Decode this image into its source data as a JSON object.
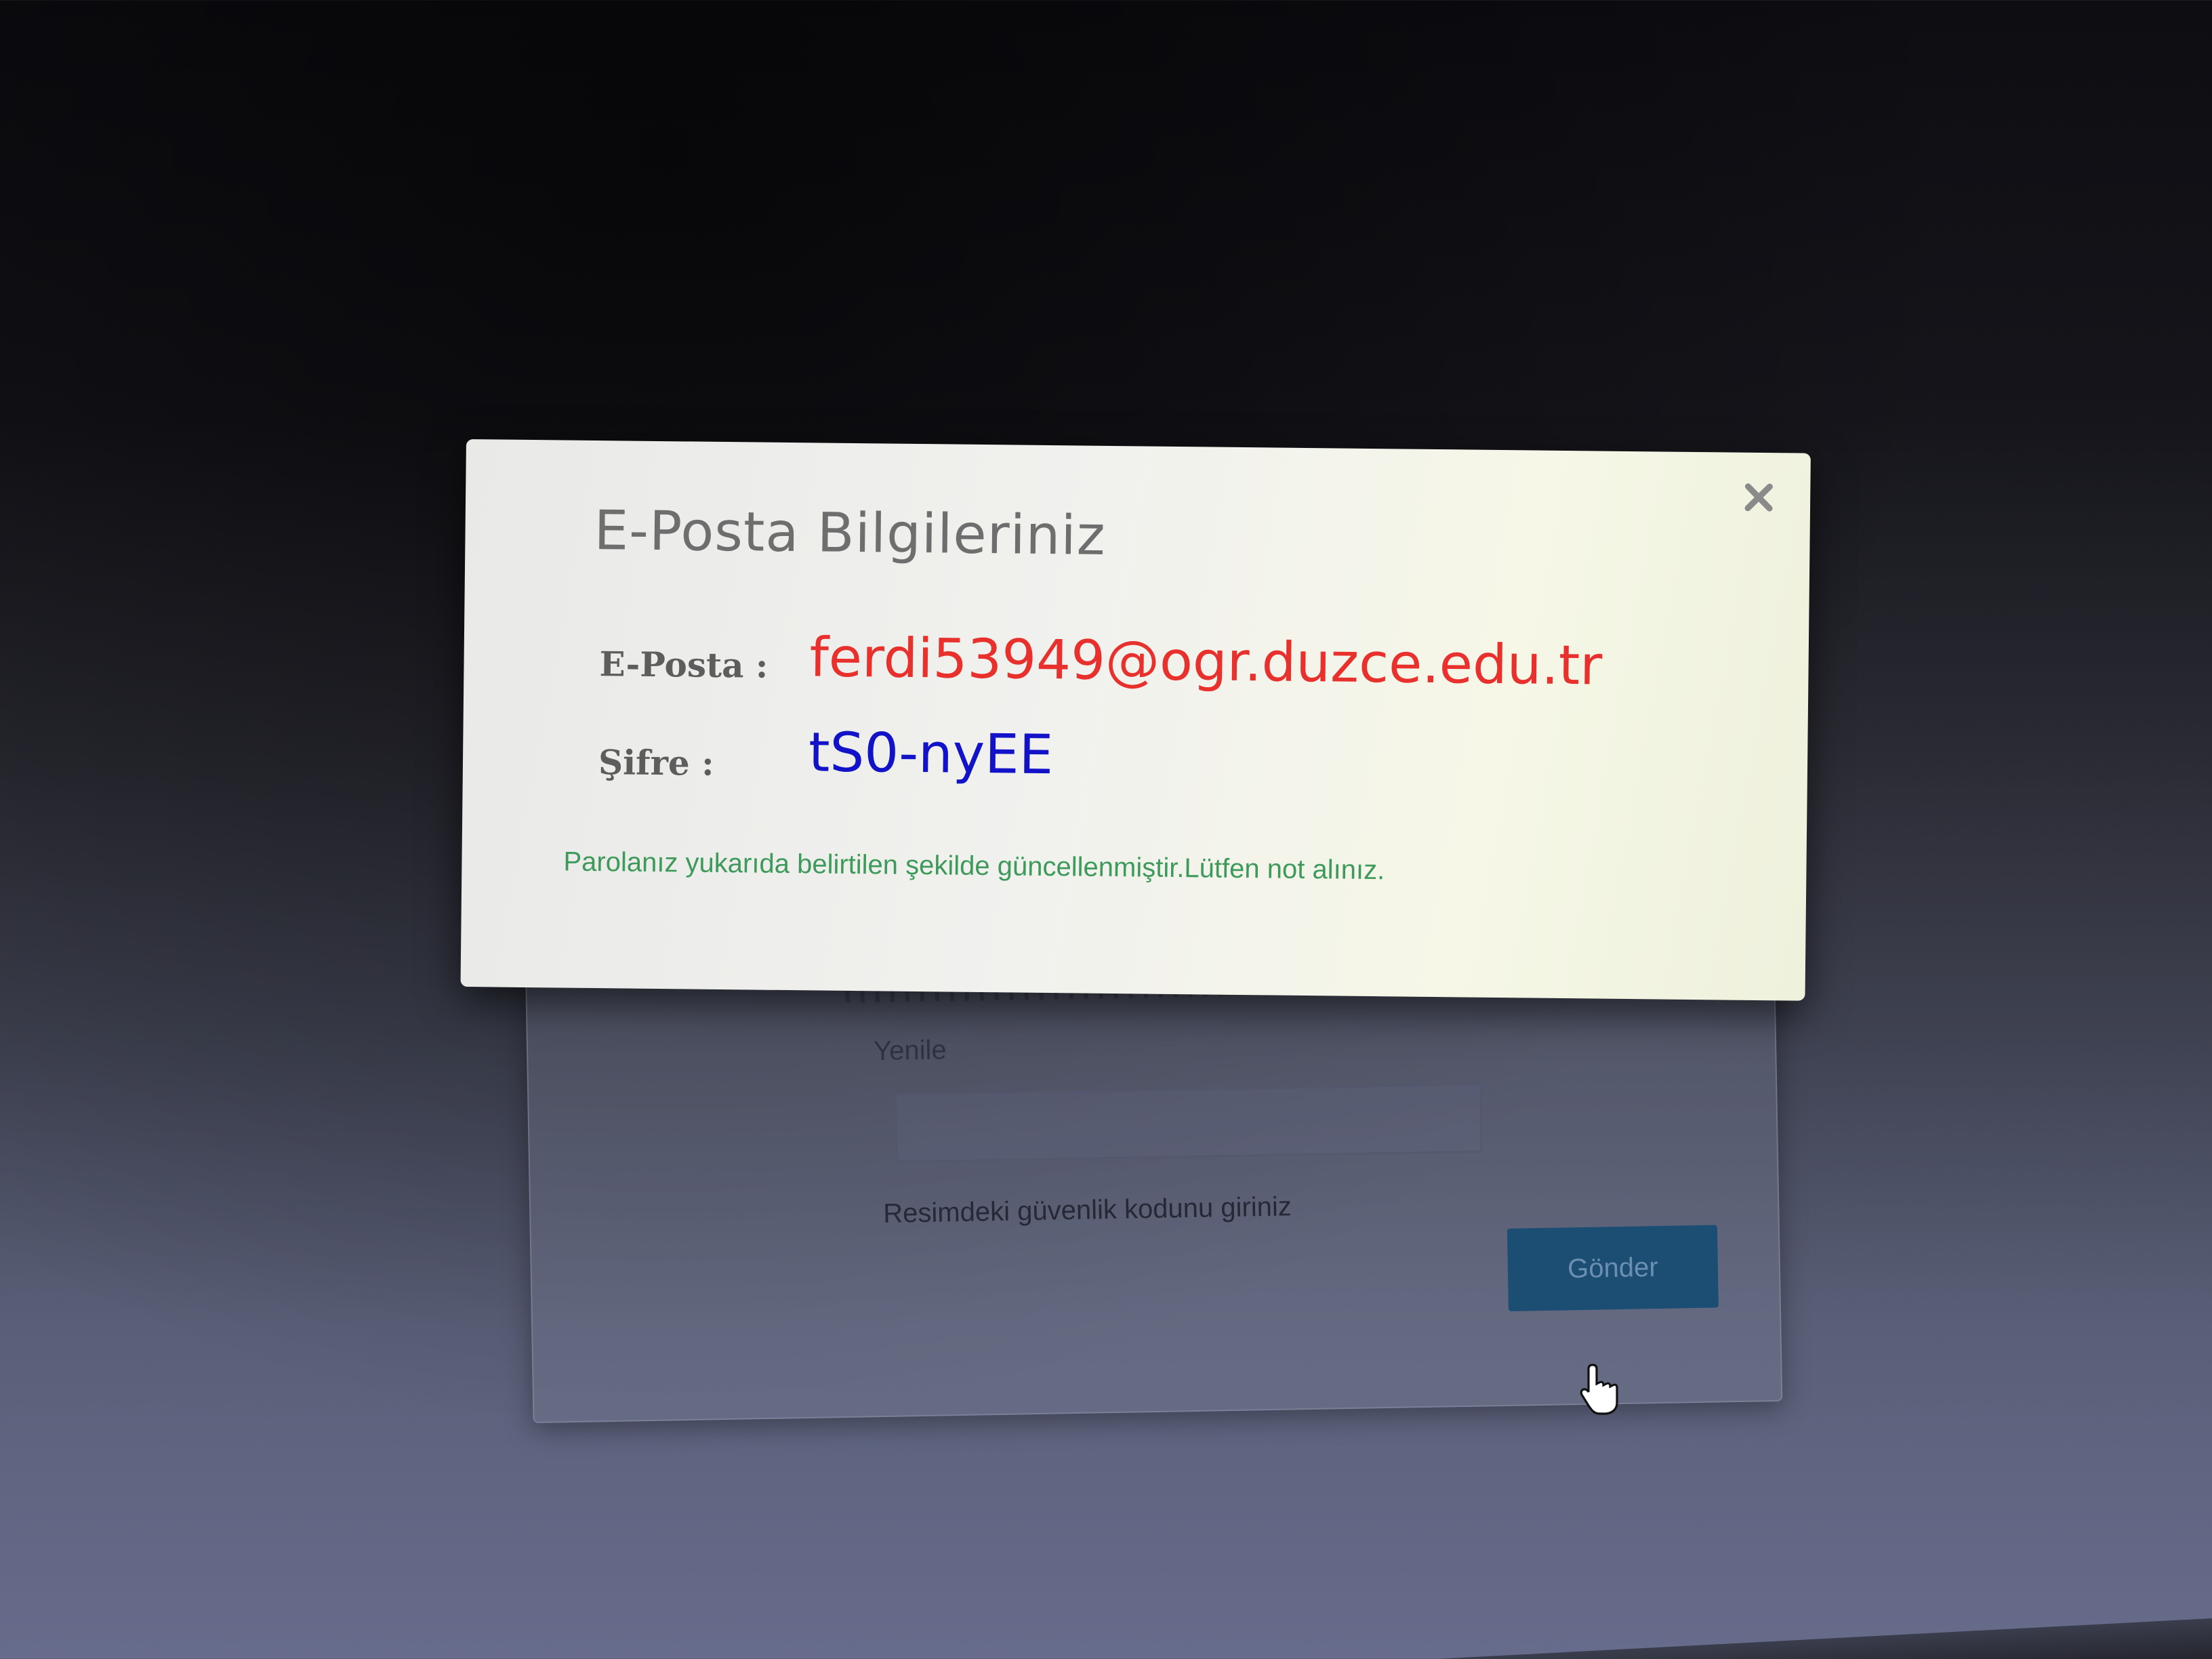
{
  "modal": {
    "title": "E-Posta Bilgileriniz",
    "close_glyph": "×",
    "email_label": "E-Posta :",
    "email_value": "ferdi53949@ogr.duzce.edu.tr",
    "password_label": "Şifre :",
    "password_value": "tS0-nyEE",
    "notice": "Parolanız yukarıda belirtilen şekilde güncellenmiştir.Lütfen not alınız."
  },
  "background_form": {
    "refresh_label": "Yenile",
    "code_hint": "Resimdeki güvenlik kodunu giriniz",
    "send_label": "Gönder"
  },
  "colors": {
    "email_value": "#e8302d",
    "password_value": "#1212c8",
    "notice": "#3e9a5a",
    "send_button": "#1c4e73"
  },
  "icons": {
    "close": "close-icon",
    "cursor": "hand-pointer-icon"
  }
}
